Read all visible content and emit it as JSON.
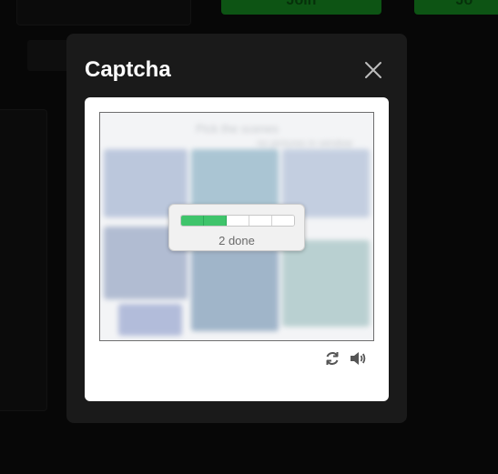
{
  "background": {
    "join_button_label": "Join",
    "join_button_label_cut": "Jo"
  },
  "modal": {
    "title": "Captcha",
    "close_icon": "close-icon"
  },
  "challenge": {
    "instruction_blurred": "Pick the scenes",
    "sub_instruction_blurred": "no pictures in window",
    "progress": {
      "completed": 2,
      "total": 5,
      "label": "2 done"
    }
  },
  "controls": {
    "refresh_icon": "refresh-icon",
    "audio_icon": "audio-icon"
  },
  "colors": {
    "accent_green": "#3fc46b",
    "join_green": "#14811f",
    "modal_bg": "#1a1a1a"
  }
}
